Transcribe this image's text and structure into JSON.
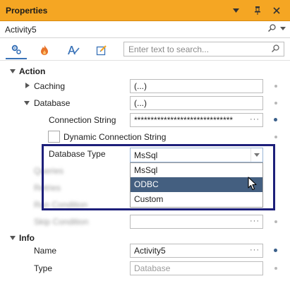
{
  "window": {
    "title": "Properties"
  },
  "object_selector": {
    "value": "Activity5"
  },
  "search": {
    "placeholder": "Enter text to search..."
  },
  "categories": {
    "action": "Action",
    "info": "Info"
  },
  "properties": {
    "caching": {
      "label": "Caching",
      "value": "(...)"
    },
    "database": {
      "label": "Database",
      "value": "(...)"
    },
    "connection_string": {
      "label": "Connection String",
      "value": "******************************"
    },
    "dynamic_connection_string": {
      "label": "Dynamic Connection String"
    },
    "database_type": {
      "label": "Database Type",
      "value": "MsSql"
    },
    "queries": {
      "label": "Queries"
    },
    "retries": {
      "label": "Retries"
    },
    "run_condition": {
      "label": "Run Condition"
    },
    "skip_condition": {
      "label": "Skip Condition"
    },
    "name": {
      "label": "Name",
      "value": "Activity5"
    },
    "type": {
      "label": "Type",
      "value": "Database"
    }
  },
  "dropdown": {
    "options": [
      "MsSql",
      "ODBC",
      "Custom"
    ],
    "hovered": "ODBC"
  },
  "ellipsis": "···",
  "colors": {
    "title_bar": "#f5a623",
    "highlight_border": "#1d1f7a",
    "hover_item": "#445f80"
  }
}
